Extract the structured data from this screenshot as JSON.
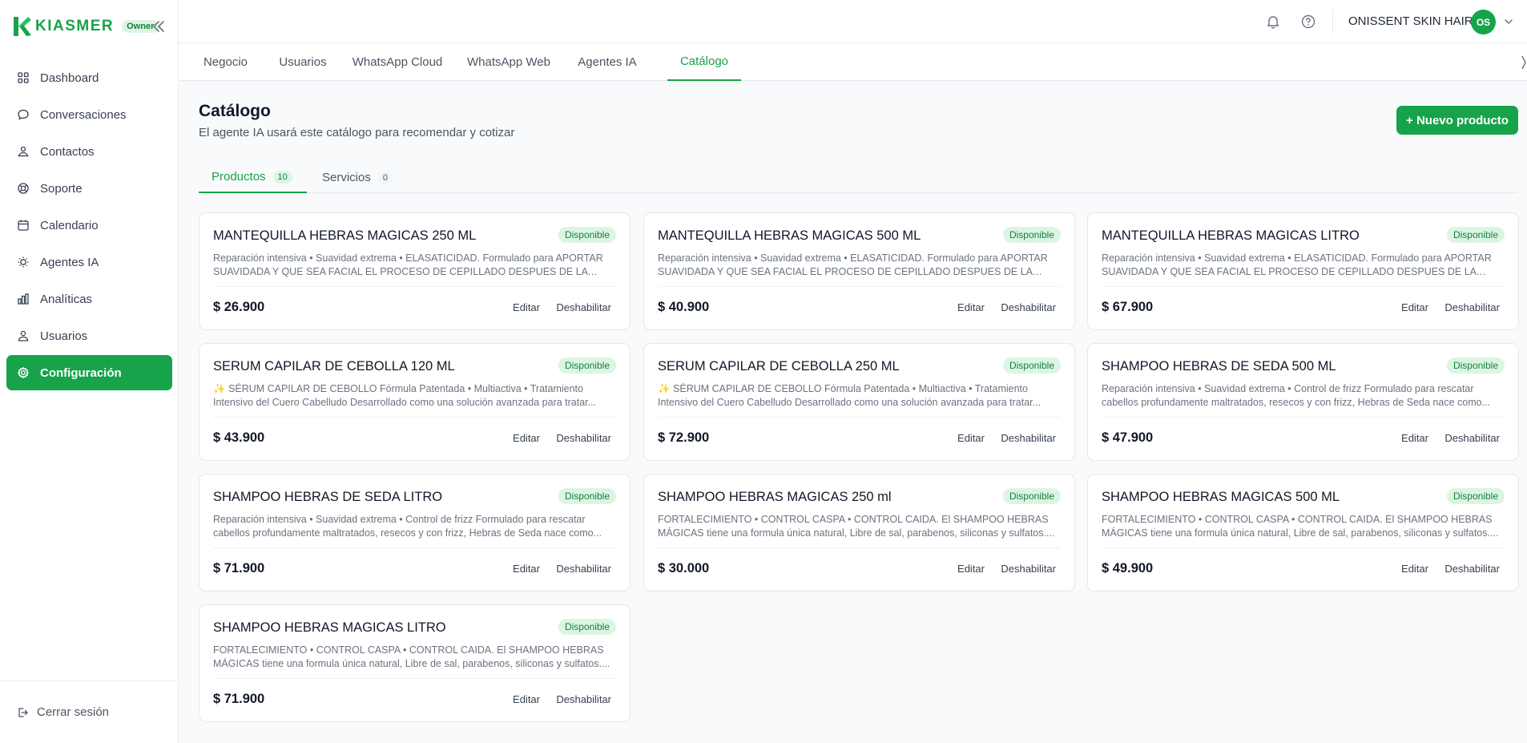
{
  "brand": {
    "name": "KIASMER",
    "role_badge": "Owner"
  },
  "colors": {
    "accent": "#16a34a",
    "badge_bg": "#dcf5e3"
  },
  "sidebar": {
    "items": [
      {
        "label": "Dashboard",
        "icon": "grid-icon"
      },
      {
        "label": "Conversaciones",
        "icon": "chat-bubble-icon"
      },
      {
        "label": "Contactos",
        "icon": "contacts-icon"
      },
      {
        "label": "Soporte",
        "icon": "lifebuoy-icon"
      },
      {
        "label": "Calendario",
        "icon": "calendar-icon"
      },
      {
        "label": "Agentes IA",
        "icon": "bulb-icon"
      },
      {
        "label": "Analíticas",
        "icon": "bar-chart-icon"
      },
      {
        "label": "Usuarios",
        "icon": "users-icon"
      },
      {
        "label": "Configuración",
        "icon": "gear-icon",
        "active": true
      }
    ],
    "logout": "Cerrar sesión"
  },
  "header": {
    "account_name": "ONISSENT SKIN HAIR",
    "avatar_initials": "OS"
  },
  "tabs": [
    "Negocio",
    "Usuarios",
    "WhatsApp Cloud",
    "WhatsApp Web",
    "Agentes IA",
    "Catálogo"
  ],
  "page": {
    "title": "Catálogo",
    "subtitle": "El agente IA usará este catálogo para recomendar y cotizar",
    "new_button": "+ Nuevo producto"
  },
  "subtabs": [
    {
      "label": "Productos",
      "count": "10"
    },
    {
      "label": "Servicios",
      "count": "0"
    }
  ],
  "card_actions": {
    "edit": "Editar",
    "disable": "Deshabilitar"
  },
  "products": [
    {
      "name": "MANTEQUILLA HEBRAS MAGICAS 250 ML",
      "status": "Disponible",
      "description": "Reparación intensiva • Suavidad extrema • ELASATICIDAD. Formulado para APORTAR SUAVIDADA Y QUE SEA FACIAL EL PROCESO DE CEPILLADO DESPUES DE LA DUCHA, ...",
      "price": "$ 26.900"
    },
    {
      "name": "MANTEQUILLA HEBRAS MAGICAS 500 ML",
      "status": "Disponible",
      "description": "Reparación intensiva • Suavidad extrema • ELASATICIDAD. Formulado para APORTAR SUAVIDADA Y QUE SEA FACIAL EL PROCESO DE CEPILLADO DESPUES DE LA DUCHA, ...",
      "price": "$ 40.900"
    },
    {
      "name": "MANTEQUILLA HEBRAS MAGICAS LITRO",
      "status": "Disponible",
      "description": "Reparación intensiva • Suavidad extrema • ELASATICIDAD. Formulado para APORTAR SUAVIDADA Y QUE SEA FACIAL EL PROCESO DE CEPILLADO DESPUES DE LA DUCHA, ...",
      "price": "$ 67.900"
    },
    {
      "name": "SERUM CAPILAR DE CEBOLLA 120 ML",
      "status": "Disponible",
      "description": "✨ SÉRUM CAPILAR DE CEBOLLO Fórmula Patentada • Multiactiva • Tratamiento Intensivo del Cuero Cabelludo Desarrollado como una solución avanzada para tratar...",
      "price": "$ 43.900"
    },
    {
      "name": "SERUM CAPILAR DE CEBOLLA 250 ML",
      "status": "Disponible",
      "description": "✨ SÉRUM CAPILAR DE CEBOLLO Fórmula Patentada • Multiactiva • Tratamiento Intensivo del Cuero Cabelludo Desarrollado como una solución avanzada para tratar...",
      "price": "$ 72.900"
    },
    {
      "name": "SHAMPOO HEBRAS DE SEDA 500 ML",
      "status": "Disponible",
      "description": "Reparación intensiva • Suavidad extrema • Control de frizz Formulado para rescatar cabellos profundamente maltratados, resecos y con frizz, Hebras de Seda nace como...",
      "price": "$ 47.900"
    },
    {
      "name": "SHAMPOO HEBRAS DE SEDA LITRO",
      "status": "Disponible",
      "description": "Reparación intensiva • Suavidad extrema • Control de frizz Formulado para rescatar cabellos profundamente maltratados, resecos y con frizz, Hebras de Seda nace como...",
      "price": "$ 71.900"
    },
    {
      "name": "SHAMPOO HEBRAS MAGICAS 250 ml",
      "status": "Disponible",
      "description": "FORTALECIMIENTO • CONTROL CASPA • CONTROL CAIDA. El SHAMPOO HEBRAS MÁGICAS tiene una formula única natural, Libre de sal, parabenos, siliconas y sulfatos....",
      "price": "$ 30.000"
    },
    {
      "name": "SHAMPOO HEBRAS MAGICAS 500 ML",
      "status": "Disponible",
      "description": "FORTALECIMIENTO • CONTROL CASPA • CONTROL CAIDA. El SHAMPOO HEBRAS MÁGICAS tiene una formula única natural, Libre de sal, parabenos, siliconas y sulfatos....",
      "price": "$ 49.900"
    },
    {
      "name": "SHAMPOO HEBRAS MAGICAS LITRO",
      "status": "Disponible",
      "description": "FORTALECIMIENTO • CONTROL CASPA • CONTROL CAIDA. El SHAMPOO HEBRAS MÁGICAS tiene una formula única natural, Libre de sal, parabenos, siliconas y sulfatos....",
      "price": "$ 71.900"
    }
  ]
}
